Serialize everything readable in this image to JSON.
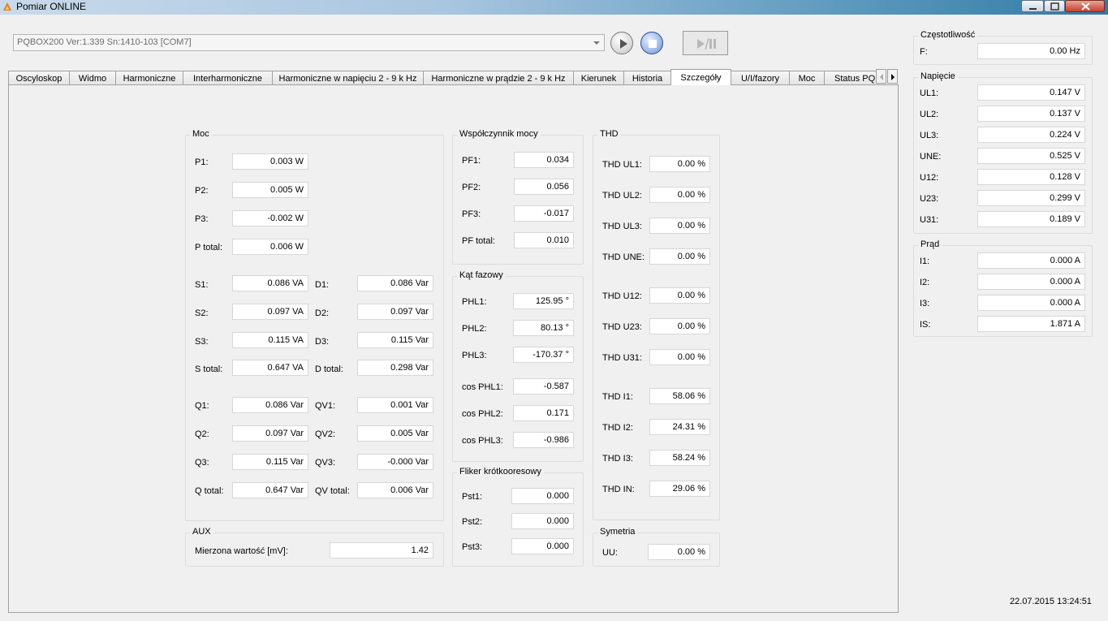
{
  "window": {
    "title": "Pomiar ONLINE"
  },
  "device": {
    "selected": "PQBOX200 Ver:1.339 Sn:1410-103 [COM7]"
  },
  "tabs": [
    {
      "label": "Oscyloskop"
    },
    {
      "label": "Widmo"
    },
    {
      "label": "Harmoniczne"
    },
    {
      "label": "Interharmoniczne"
    },
    {
      "label": "Harmoniczne w napięciu 2 - 9 k Hz"
    },
    {
      "label": "Harmoniczne w prądzie 2 - 9 k Hz"
    },
    {
      "label": "Kierunek"
    },
    {
      "label": "Historia"
    },
    {
      "label": "Szczegóły"
    },
    {
      "label": "U/I/fazory"
    },
    {
      "label": "Moc"
    },
    {
      "label": "Status PQ"
    }
  ],
  "moc": {
    "title": "Moc",
    "rows": [
      {
        "label": "P1:",
        "value": "0.003 W"
      },
      {
        "label": "P2:",
        "value": "0.005 W"
      },
      {
        "label": "P3:",
        "value": "-0.002 W"
      },
      {
        "label": "P total:",
        "value": "0.006 W"
      }
    ],
    "s_rows": [
      {
        "label": "S1:",
        "value": "0.086 VA"
      },
      {
        "label": "S2:",
        "value": "0.097 VA"
      },
      {
        "label": "S3:",
        "value": "0.115 VA"
      },
      {
        "label": "S total:",
        "value": "0.647 VA"
      }
    ],
    "d_rows": [
      {
        "label": "D1:",
        "value": "0.086 Var"
      },
      {
        "label": "D2:",
        "value": "0.097 Var"
      },
      {
        "label": "D3:",
        "value": "0.115 Var"
      },
      {
        "label": "D total:",
        "value": "0.298 Var"
      }
    ],
    "q_rows": [
      {
        "label": "Q1:",
        "value": "0.086 Var"
      },
      {
        "label": "Q2:",
        "value": "0.097 Var"
      },
      {
        "label": "Q3:",
        "value": "0.115 Var"
      },
      {
        "label": "Q total:",
        "value": "0.647 Var"
      }
    ],
    "qv_rows": [
      {
        "label": "QV1:",
        "value": "0.001 Var"
      },
      {
        "label": "QV2:",
        "value": "0.005 Var"
      },
      {
        "label": "QV3:",
        "value": "-0.000 Var"
      },
      {
        "label": "QV total:",
        "value": "0.006 Var"
      }
    ]
  },
  "aux": {
    "title": "AUX",
    "label": "Mierzona wartość [mV]:",
    "value": "1.42"
  },
  "pf": {
    "title": "Współczynnik mocy",
    "rows": [
      {
        "label": "PF1:",
        "value": "0.034"
      },
      {
        "label": "PF2:",
        "value": "0.056"
      },
      {
        "label": "PF3:",
        "value": "-0.017"
      },
      {
        "label": "PF total:",
        "value": "0.010"
      }
    ]
  },
  "kat": {
    "title": "Kąt fazowy",
    "rows": [
      {
        "label": "PHL1:",
        "value": "125.95 °"
      },
      {
        "label": "PHL2:",
        "value": "80.13 °"
      },
      {
        "label": "PHL3:",
        "value": "-170.37 °"
      },
      {
        "label": "cos PHL1:",
        "value": "-0.587"
      },
      {
        "label": "cos PHL2:",
        "value": "0.171"
      },
      {
        "label": "cos PHL3:",
        "value": "-0.986"
      }
    ]
  },
  "fliker": {
    "title": "Fliker krótkooresowy",
    "rows": [
      {
        "label": "Pst1:",
        "value": "0.000"
      },
      {
        "label": "Pst2:",
        "value": "0.000"
      },
      {
        "label": "Pst3:",
        "value": "0.000"
      }
    ]
  },
  "thd": {
    "title": "THD",
    "rows": [
      {
        "label": "THD UL1:",
        "value": "0.00 %"
      },
      {
        "label": "THD UL2:",
        "value": "0.00 %"
      },
      {
        "label": "THD UL3:",
        "value": "0.00 %"
      },
      {
        "label": "THD UNE:",
        "value": "0.00 %"
      },
      {
        "label": "THD U12:",
        "value": "0.00 %"
      },
      {
        "label": "THD U23:",
        "value": "0.00 %"
      },
      {
        "label": "THD U31:",
        "value": "0.00 %"
      },
      {
        "label": "THD I1:",
        "value": "58.06 %"
      },
      {
        "label": "THD I2:",
        "value": "24.31 %"
      },
      {
        "label": "THD I3:",
        "value": "58.24 %"
      },
      {
        "label": "THD IN:",
        "value": "29.06 %"
      }
    ]
  },
  "symetria": {
    "title": "Symetria",
    "label": "UU:",
    "value": "0.00 %"
  },
  "czestotliwosc": {
    "title": "Częstotliwość",
    "label": "F:",
    "value": "0.00 Hz"
  },
  "napiecie": {
    "title": "Napięcie",
    "rows": [
      {
        "label": "UL1:",
        "value": "0.147 V"
      },
      {
        "label": "UL2:",
        "value": "0.137 V"
      },
      {
        "label": "UL3:",
        "value": "0.224 V"
      },
      {
        "label": "UNE:",
        "value": "0.525 V"
      },
      {
        "label": "U12:",
        "value": "0.128 V"
      },
      {
        "label": "U23:",
        "value": "0.299 V"
      },
      {
        "label": "U31:",
        "value": "0.189 V"
      }
    ]
  },
  "prad": {
    "title": "Prąd",
    "rows": [
      {
        "label": "I1:",
        "value": "0.000 A"
      },
      {
        "label": "I2:",
        "value": "0.000 A"
      },
      {
        "label": "I3:",
        "value": "0.000 A"
      },
      {
        "label": "IS:",
        "value": "1.871 A"
      }
    ]
  },
  "timestamp": "22.07.2015 13:24:51",
  "colors": {
    "active_tab": "#ffffff",
    "background": "#f0f0f0",
    "stop_button": "#2e4f8e"
  }
}
